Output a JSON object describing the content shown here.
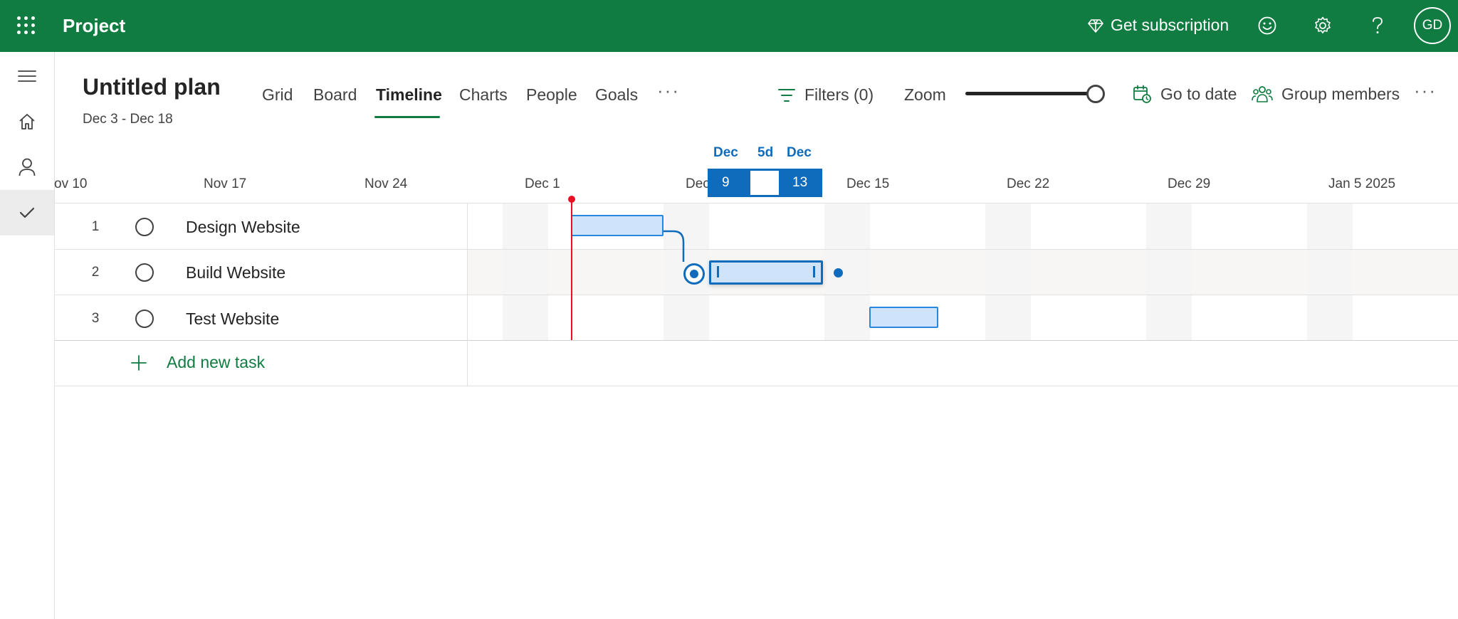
{
  "app": {
    "title": "Project",
    "subscription_label": "Get subscription",
    "user_initials": "GD"
  },
  "icons": {
    "waffle": "app-launcher-icon",
    "diamond": "diamond-icon",
    "feedback": "smiley-icon",
    "settings": "gear-icon",
    "help": "question-icon",
    "menu": "hamburger-icon",
    "home": "home-icon",
    "person": "person-icon",
    "tasks": "checkmark-icon"
  },
  "colors": {
    "brand": "#107c41",
    "accent": "#0f6cbd",
    "bar_fill": "#cfe4fa",
    "today": "#e81123"
  },
  "plan": {
    "title": "Untitled plan",
    "dates": "Dec 3 - Dec 18"
  },
  "tabs": [
    {
      "label": "Grid"
    },
    {
      "label": "Board"
    },
    {
      "label": "Timeline",
      "active": true
    },
    {
      "label": "Charts"
    },
    {
      "label": "People"
    },
    {
      "label": "Goals"
    }
  ],
  "more_label": "···",
  "toolbar": {
    "filters_label": "Filters (0)",
    "zoom_label": "Zoom",
    "zoom_level": 1.0,
    "goto_label": "Go to date",
    "group_label": "Group members",
    "more_label": "···"
  },
  "timeline": {
    "dates": [
      "ov 10",
      "Nov 17",
      "Nov 24",
      "Dec 1",
      "Dec",
      "Dec 15",
      "Dec 22",
      "Dec 29",
      "Jan 5 2025"
    ],
    "selection": {
      "start_month": "Dec",
      "start_day": "9",
      "duration": "5d",
      "end_month": "Dec",
      "end_day": "13"
    }
  },
  "tasks": [
    {
      "num": "1",
      "name": "Design Website"
    },
    {
      "num": "2",
      "name": "Build Website"
    },
    {
      "num": "3",
      "name": "Test Website"
    }
  ],
  "add_task_label": "Add new task"
}
